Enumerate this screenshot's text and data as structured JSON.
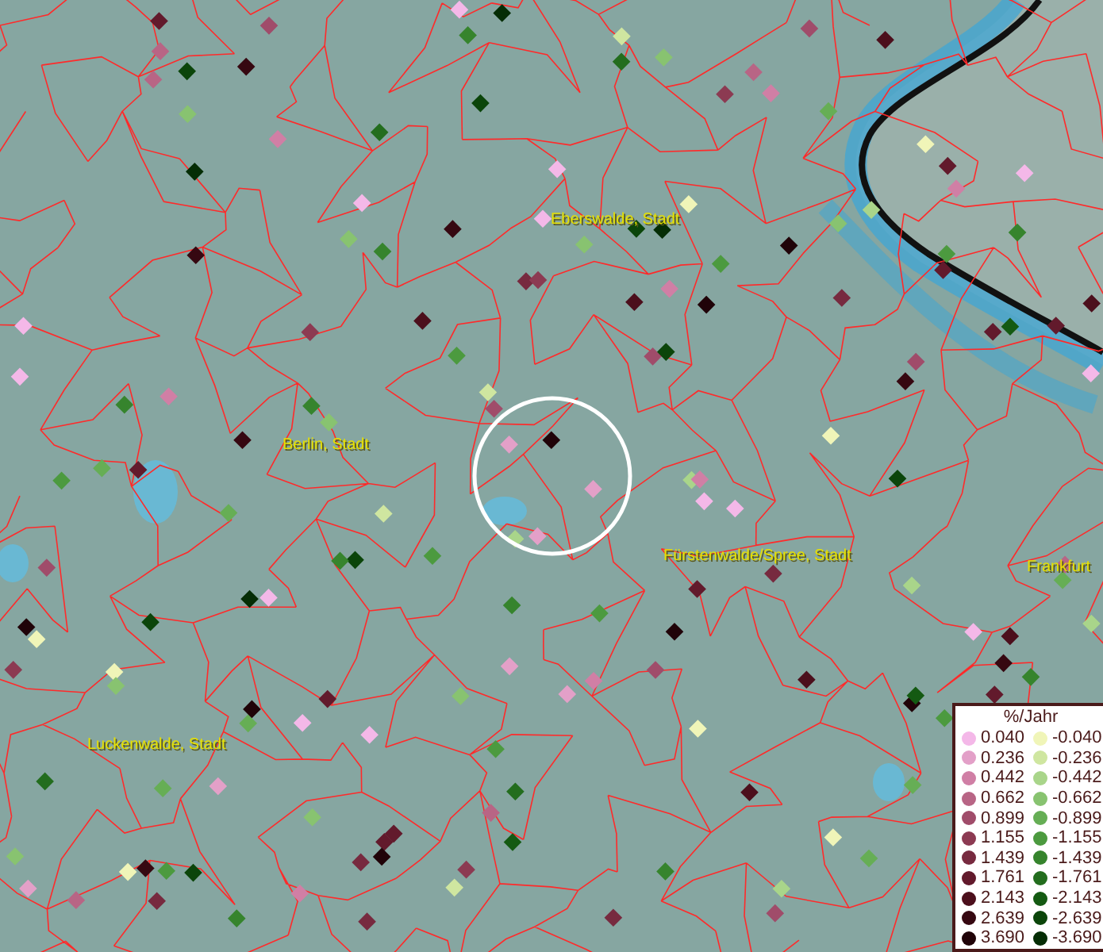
{
  "map": {
    "place_labels": [
      {
        "text": "Eberswalde, Stadt"
      },
      {
        "text": "Berlin, Stadt"
      },
      {
        "text": "Fürstenwalde/Spree, Stadt"
      },
      {
        "text": "Frankfurt"
      },
      {
        "text": "Luckenwalde, Stadt"
      }
    ]
  },
  "legend": {
    "title": "%/Jahr",
    "rows": [
      {
        "positive": {
          "value": "0.040",
          "color": "#f4b8e8"
        },
        "negative": {
          "value": "-0.040",
          "color": "#f0f5b8"
        }
      },
      {
        "positive": {
          "value": "0.236",
          "color": "#e3a0c8"
        },
        "negative": {
          "value": "-0.236",
          "color": "#cfe6a0"
        }
      },
      {
        "positive": {
          "value": "0.442",
          "color": "#d07fa5"
        },
        "negative": {
          "value": "-0.442",
          "color": "#a9d58a"
        }
      },
      {
        "positive": {
          "value": "0.662",
          "color": "#b86585"
        },
        "negative": {
          "value": "-0.662",
          "color": "#88c370"
        }
      },
      {
        "positive": {
          "value": "0.899",
          "color": "#a04c6a"
        },
        "negative": {
          "value": "-0.899",
          "color": "#66ae55"
        }
      },
      {
        "positive": {
          "value": "1.155",
          "color": "#8c3a52"
        },
        "negative": {
          "value": "-1.155",
          "color": "#4c9a3f"
        }
      },
      {
        "positive": {
          "value": "1.439",
          "color": "#772a3f"
        },
        "negative": {
          "value": "-1.439",
          "color": "#36842d"
        }
      },
      {
        "positive": {
          "value": "1.761",
          "color": "#621a2c"
        },
        "negative": {
          "value": "-1.761",
          "color": "#236d1e"
        }
      },
      {
        "positive": {
          "value": "2.143",
          "color": "#4c0f1c"
        },
        "negative": {
          "value": "-2.143",
          "color": "#145a12"
        }
      },
      {
        "positive": {
          "value": "2.639",
          "color": "#360811"
        },
        "negative": {
          "value": "-2.639",
          "color": "#0b450a"
        }
      },
      {
        "positive": {
          "value": "3.690",
          "color": "#200308"
        },
        "negative": {
          "value": "-3.690",
          "color": "#052d05"
        }
      }
    ]
  }
}
